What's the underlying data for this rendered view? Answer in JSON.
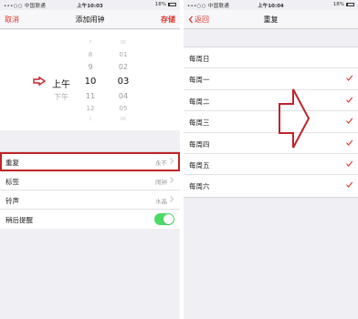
{
  "status_left": {
    "carrier": "•••○○ 中国联通",
    "time": "上午10:03",
    "battery": "18%"
  },
  "status_right": {
    "carrier": "•••○○ 中国联通",
    "time": "上午10:04",
    "battery": "18%"
  },
  "left_nav": {
    "cancel": "取消",
    "title": "添加闹钟",
    "save": "存储"
  },
  "picker": {
    "ampm": {
      "above": [
        "",
        ""
      ],
      "selected": "上午",
      "below": [
        "下午",
        ""
      ]
    },
    "hours": {
      "above": [
        "7",
        "8",
        "9"
      ],
      "selected": "10",
      "below": [
        "11",
        "12",
        "1"
      ]
    },
    "minutes": {
      "above": [
        "00",
        "01",
        "02"
      ],
      "selected": "03",
      "below": [
        "04",
        "05",
        "06"
      ]
    }
  },
  "settings": {
    "repeat": {
      "label": "重复",
      "value": "永不"
    },
    "tag": {
      "label": "标签",
      "value": "闹钟"
    },
    "ringtone": {
      "label": "铃声",
      "value": "水晶"
    },
    "snooze": {
      "label": "稍后提醒",
      "on": true
    }
  },
  "right_nav": {
    "back": "返回",
    "title": "重复"
  },
  "days": [
    {
      "label": "每周日",
      "checked": false
    },
    {
      "label": "每周一",
      "checked": true
    },
    {
      "label": "每周二",
      "checked": true
    },
    {
      "label": "每周三",
      "checked": true
    },
    {
      "label": "每周四",
      "checked": true
    },
    {
      "label": "每周五",
      "checked": true
    },
    {
      "label": "每周六",
      "checked": true
    }
  ],
  "colors": {
    "accent": "#e0332e",
    "annotation": "#c0232a",
    "toggle_on": "#4cd964"
  }
}
